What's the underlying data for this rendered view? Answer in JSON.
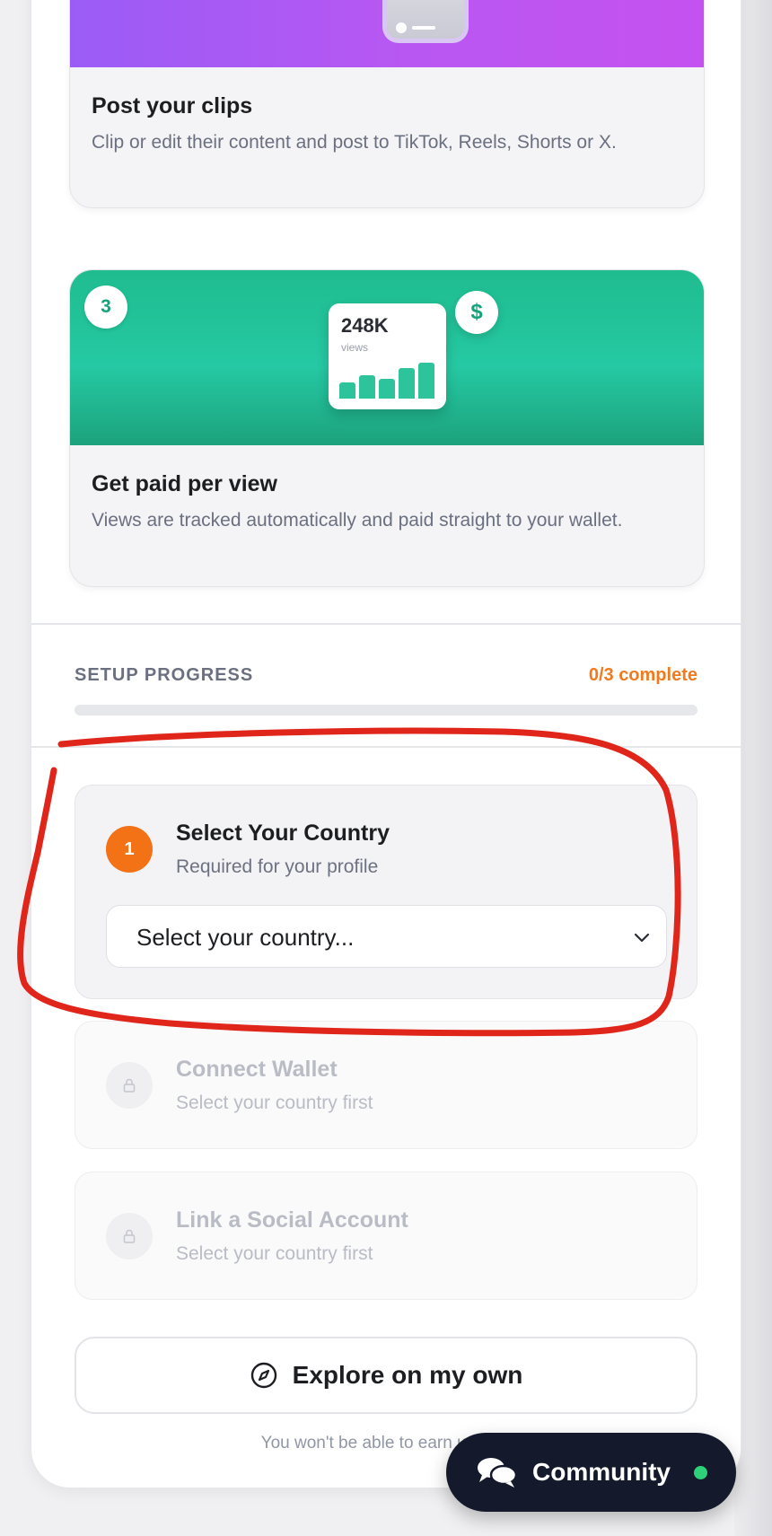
{
  "steps": {
    "post": {
      "title": "Post your clips",
      "description": "Clip or edit their content and post to TikTok, Reels, Shorts or X."
    },
    "paid": {
      "badge": "3",
      "stat_value": "248K",
      "stat_label": "views",
      "currency_symbol": "$",
      "title": "Get paid per view",
      "description": "Views are tracked automatically and paid straight to your wallet."
    }
  },
  "setup": {
    "label": "SETUP PROGRESS",
    "status": "0/3 complete",
    "completed": 0,
    "total": 3,
    "accent_color": "#f07a1d"
  },
  "tasks": [
    {
      "number": "1",
      "title": "Select Your Country",
      "subtitle": "Required for your profile",
      "select_value": "Select your country...",
      "icon": "chevron-down-icon"
    },
    {
      "title": "Connect Wallet",
      "subtitle": "Select your country first",
      "icon": "lock-icon"
    },
    {
      "title": "Link a Social Account",
      "subtitle": "Select your country first",
      "icon": "lock-icon"
    }
  ],
  "explore": {
    "label": "Explore on my own",
    "icon": "compass-icon"
  },
  "footnote": "You won't be able to earn until se",
  "community": {
    "label": "Community",
    "icon": "chat-bubbles-icon",
    "status_color": "#2ed07a"
  },
  "annotation": {
    "color": "#e0261b",
    "shape": "hand-drawn circle around Select Your Country"
  }
}
